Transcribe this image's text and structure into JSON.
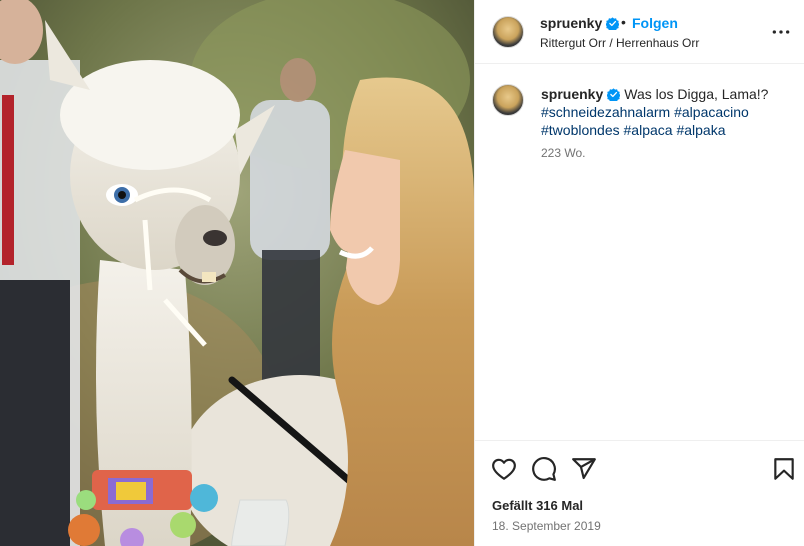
{
  "post": {
    "image_alt": "",
    "header": {
      "username": "spruenky",
      "separator": "•",
      "follow_label": "Folgen",
      "location": "Rittergut Orr / Herrenhaus Orr"
    },
    "caption": {
      "username": "spruenky",
      "text": "Was los Digga, Lama!?",
      "hashtags": [
        "#schneidezahnalarm",
        "#alpacacino",
        "#twoblondes",
        "#alpaca",
        "#alpaka"
      ],
      "time_ago": "223 Wo."
    },
    "actions": {
      "like_icon": "heart-outline-icon",
      "comment_icon": "comment-bubble-icon",
      "share_icon": "paper-plane-icon",
      "save_icon": "bookmark-icon",
      "likes_text": "Gefällt 316 Mal",
      "date_text": "18. September 2019"
    }
  },
  "colors": {
    "follow": "#0095f6",
    "hashtag": "#00376b",
    "verified": "#0095f6",
    "muted_text": "#737373",
    "divider": "#efefef"
  }
}
